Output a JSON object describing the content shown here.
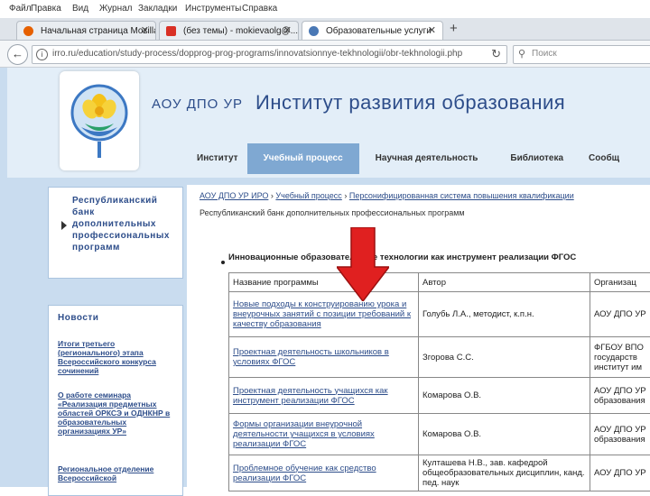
{
  "browser": {
    "menu": [
      "Файл",
      "Правка",
      "Вид",
      "Журнал",
      "Закладки",
      "Инструменты",
      "Справка"
    ],
    "tabs": [
      {
        "label": "Начальная страница Mozilla ...",
        "close": "✕",
        "color": "#e66000"
      },
      {
        "label": "(без темы) - mokievaolg@...",
        "close": "✕",
        "color": "#d93025"
      },
      {
        "label": "Образовательные услуги",
        "close": "✕",
        "color": "#4a78b5"
      }
    ],
    "new_tab": "+",
    "back_icon": "arrow-left-icon",
    "url": "irro.ru/education/study-process/dopprog-prog-programs/innovatsionnye-tekhnologii/obr-tekhnologii.php",
    "reload_icon": "reload-icon",
    "search_placeholder": "Поиск"
  },
  "header": {
    "org_small": "АОУ ДПО УР",
    "org_big": "Институт развития образования"
  },
  "nav": {
    "items": [
      "Институт",
      "Учебный процесс",
      "Научная деятельность",
      "Библиотека",
      "Сообщ"
    ],
    "active": "Учебный процесс"
  },
  "left": {
    "title": "Республиканский банк дополнительных профессиональных программ"
  },
  "news": {
    "head": "Новости",
    "items": [
      "Итоги третьего (регионального) этапа Всероссийского конкурса сочинений",
      "О работе семинара «Реализация предметных областей ОРКСЭ и ОДНКНР в образовательных организациях УР»",
      "Региональное отделение Всероссийской"
    ]
  },
  "content": {
    "breadcrumb": [
      "АОУ ДПО УР ИРО",
      "Учебный процесс",
      "Персонифицированная система повышения квалификации"
    ],
    "breadcrumb_sep": "›",
    "subcrumb": "Республиканский банк дополнительных профессиональных программ",
    "section_title": "Инновационные образовательные технологии как инструмент реализации ФГОС",
    "table": {
      "headers": [
        "Название программы",
        "Автор",
        "Организац"
      ],
      "rows": [
        [
          "Новые подходы к конструированию урока и внеурочных занятий с позиции требований к качеству образования",
          "Голубь Л.А., методист, к.п.н.",
          "АОУ ДПО УР"
        ],
        [
          "Проектная деятельность школьников в условиях ФГОС",
          "Згорова С.С.",
          "ФГБОУ ВПО государств институт им"
        ],
        [
          "Проектная деятельность учащихся как инструмент реализации ФГОС",
          "Комарова О.В.",
          "АОУ ДПО УР образования"
        ],
        [
          "Формы организации внеурочной деятельности учащихся в условиях реализации ФГОС",
          "Комарова О.В.",
          "АОУ ДПО УР образования"
        ],
        [
          "Проблемное обучение как средство реализации ФГОС",
          "Култашева Н.В., зав. кафедрой общеобразовательных дисциплин, канд. пед. наук",
          "АОУ ДПО УР"
        ]
      ]
    }
  },
  "colors": {
    "accent_blue": "#2d4d8a",
    "nav_active_bg": "#7fa8d2",
    "arrow_red": "#e02020",
    "page_bg": "#c9dcef"
  }
}
